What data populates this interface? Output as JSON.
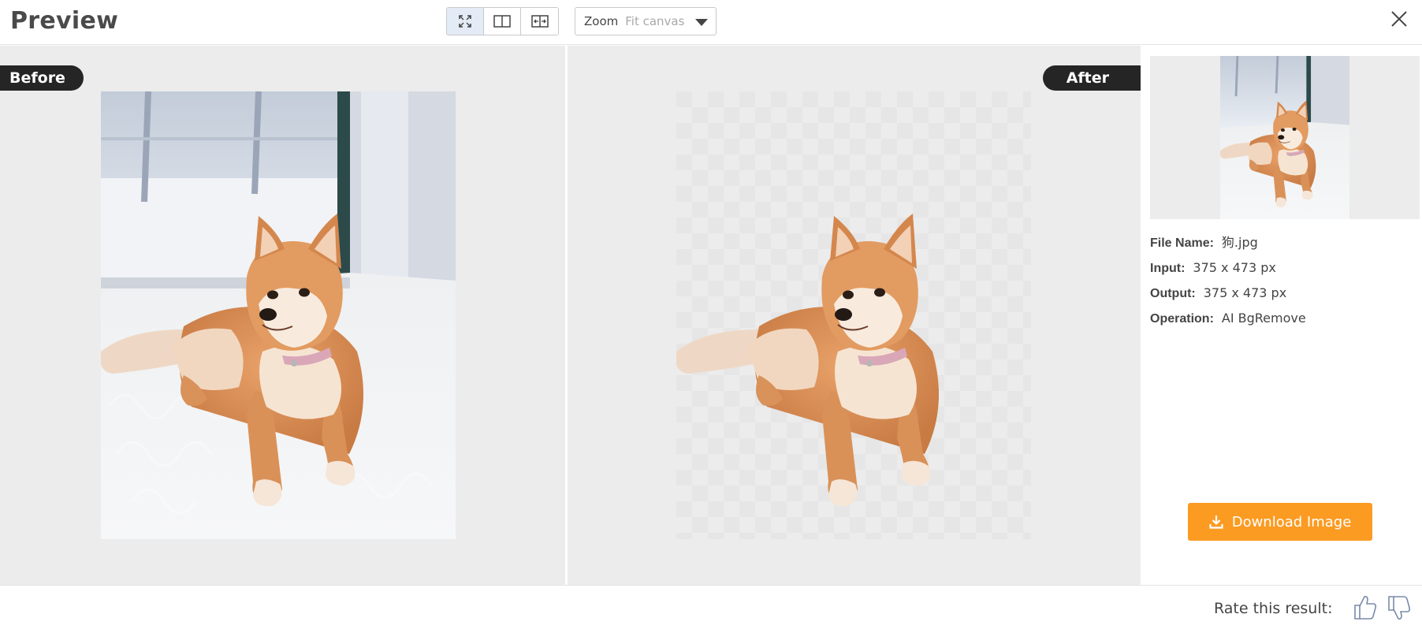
{
  "header": {
    "title": "Preview",
    "view_modes": [
      {
        "icon": "fit-expand-icon",
        "active": true
      },
      {
        "icon": "split-view-icon",
        "active": false
      },
      {
        "icon": "compare-slider-icon",
        "active": false
      }
    ],
    "zoom": {
      "label": "Zoom",
      "value": "Fit canvas"
    },
    "close_icon": "close-icon"
  },
  "before": {
    "badge": "Before"
  },
  "after": {
    "badge": "After"
  },
  "details": {
    "file_name_label": "File Name:",
    "file_name": "狗.jpg",
    "input_label": "Input:",
    "input": "375 x 473 px",
    "output_label": "Output:",
    "output": "375 x 473 px",
    "operation_label": "Operation:",
    "operation": "AI BgRemove"
  },
  "download": {
    "label": "Download Image",
    "icon": "download-icon"
  },
  "footer": {
    "rate_label": "Rate this result:",
    "up_icon": "thumbs-up-icon",
    "down_icon": "thumbs-down-icon"
  },
  "colors": {
    "accent": "#fb9b22",
    "badge": "#252525",
    "panel_bg": "#ececec",
    "active_view": "#e3ebf6"
  }
}
